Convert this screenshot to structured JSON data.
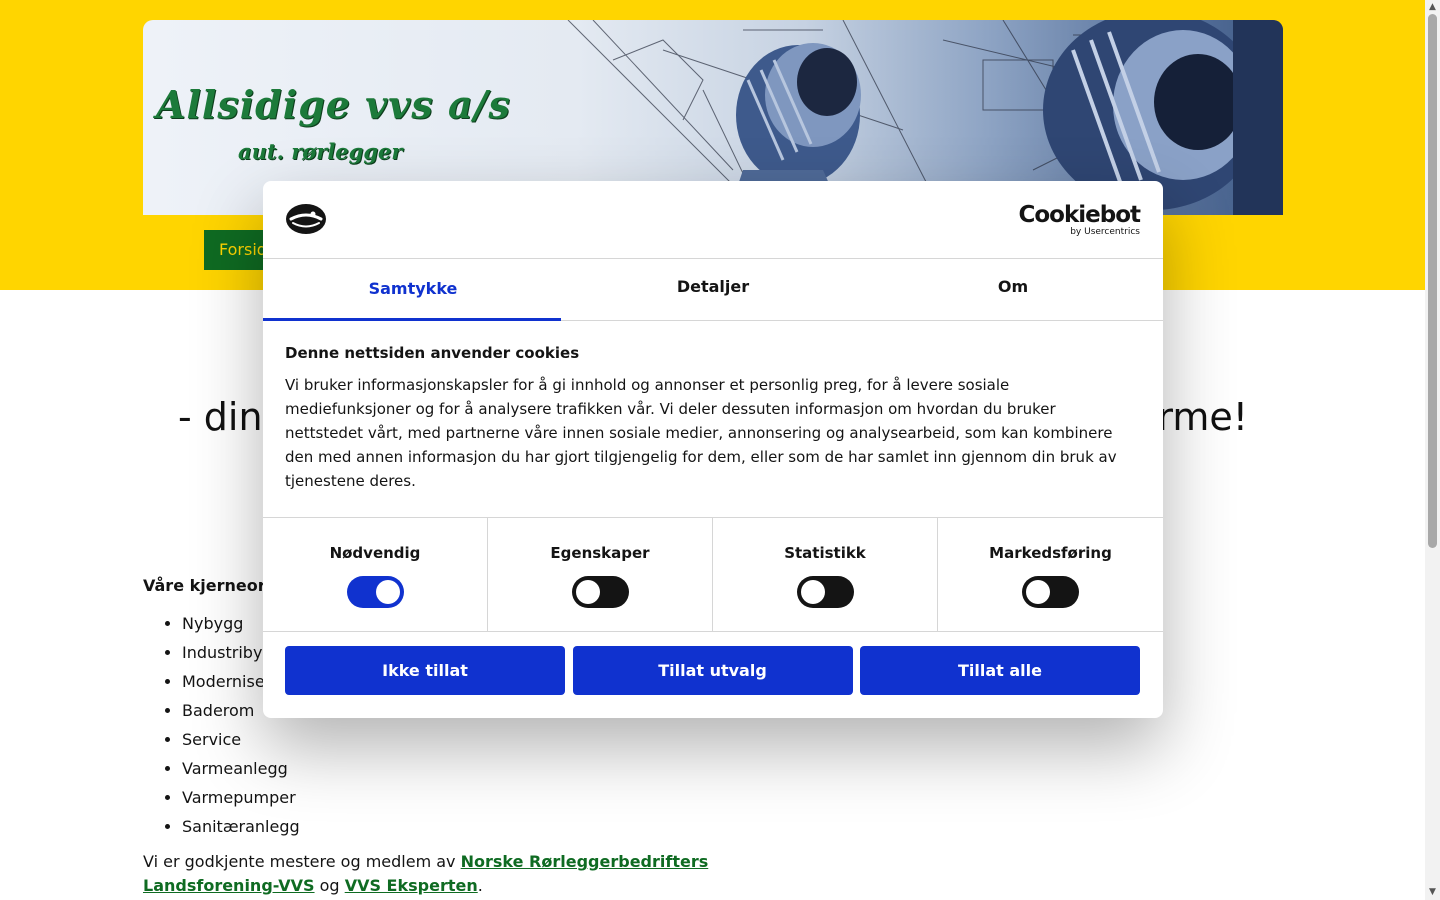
{
  "site": {
    "logo_title": "Allsidige vvs a/s",
    "logo_subtitle": "aut. rørlegger",
    "nav": {
      "home_label": "Forside"
    },
    "tagline_start": "- din",
    "tagline_end": "rme!",
    "core_heading": "Våre kjerneor",
    "core_items": [
      "Nybygg",
      "Industriby",
      "Modernise",
      "Baderom",
      "Service",
      "Varmeanlegg",
      "Varmepumper",
      "Sanitæranlegg"
    ],
    "member_text_prefix": "Vi er godkjente mestere og medlem av",
    "member_link_1": "Norske Rørleggerbedrifters Landsforening-VVS",
    "member_text_mid": "og",
    "member_link_2": "VVS Eksperten",
    "member_text_end": ".",
    "colors": {
      "band": "#ffd500",
      "nav_green": "#0f6b22",
      "link_green": "#0f6b22"
    }
  },
  "cookie_dialog": {
    "brand_name": "Cookiebot",
    "brand_by": "by Usercentrics",
    "tabs": [
      {
        "label": "Samtykke",
        "active": true
      },
      {
        "label": "Detaljer",
        "active": false
      },
      {
        "label": "Om",
        "active": false
      }
    ],
    "heading": "Denne nettsiden anvender cookies",
    "body": "Vi bruker informasjonskapsler for å gi innhold og annonser et personlig preg, for å levere sosiale mediefunksjoner og for å analysere trafikken vår. Vi deler dessuten informasjon om hvordan du bruker nettstedet vårt, med partnerne våre innen sosiale medier, annonsering og analysearbeid, som kan kombinere den med annen informasjon du har gjort tilgjengelig for dem, eller som de har samlet inn gjennom din bruk av tjenestene deres.",
    "categories": [
      {
        "label": "Nødvendig",
        "enabled": true
      },
      {
        "label": "Egenskaper",
        "enabled": false
      },
      {
        "label": "Statistikk",
        "enabled": false
      },
      {
        "label": "Markedsføring",
        "enabled": false
      }
    ],
    "buttons": {
      "deny": "Ikke tillat",
      "allow_selection": "Tillat utvalg",
      "allow_all": "Tillat alle"
    },
    "colors": {
      "accent": "#1032cf",
      "toggle_off": "#141414"
    }
  }
}
